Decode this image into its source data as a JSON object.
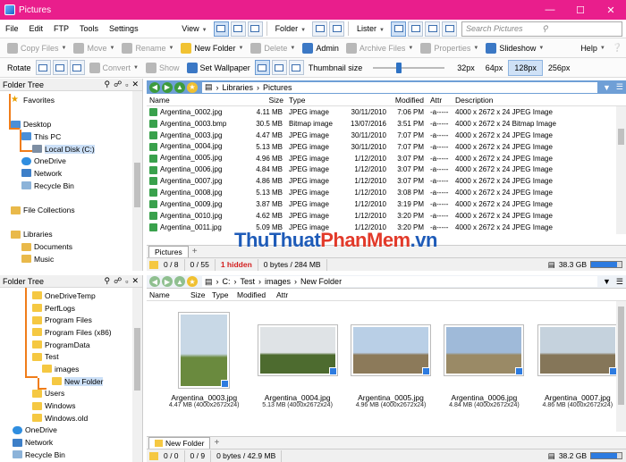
{
  "window": {
    "title": "Pictures"
  },
  "menu": {
    "items": [
      "File",
      "Edit",
      "FTP",
      "Tools",
      "Settings"
    ],
    "view_label": "View",
    "folder_label": "Folder",
    "lister_label": "Lister",
    "search_placeholder": "Search Pictures",
    "help_label": "Help"
  },
  "toolbar1": {
    "copy": "Copy Files",
    "move": "Move",
    "rename": "Rename",
    "new_folder": "New Folder",
    "delete": "Delete",
    "admin": "Admin",
    "archive": "Archive Files",
    "properties": "Properties",
    "slideshow": "Slideshow"
  },
  "toolbar2": {
    "rotate": "Rotate",
    "convert": "Convert",
    "show": "Show",
    "set_wallpaper": "Set Wallpaper",
    "thumb_size_label": "Thumbnail size",
    "thumb_level": 0.35,
    "sizes": [
      "32px",
      "64px",
      "128px",
      "256px"
    ],
    "active_size": "128px"
  },
  "tree_top": {
    "title": "Folder Tree",
    "items": [
      {
        "label": "Favorites",
        "icon": "star-icon",
        "indent": 0,
        "kind": "star"
      },
      {
        "label": "",
        "kind": "blank"
      },
      {
        "label": "Desktop",
        "icon": "desktop-icon",
        "indent": 0,
        "kind": "pc"
      },
      {
        "label": "This PC",
        "icon": "pc-icon",
        "indent": 1,
        "kind": "pc"
      },
      {
        "label": "Local Disk (C:)",
        "icon": "drive-icon",
        "indent": 2,
        "kind": "drive",
        "selected": true
      },
      {
        "label": "OneDrive",
        "icon": "cloud-icon",
        "indent": 1,
        "kind": "cloud"
      },
      {
        "label": "Network",
        "icon": "network-icon",
        "indent": 1,
        "kind": "net"
      },
      {
        "label": "Recycle Bin",
        "icon": "recycle-bin-icon",
        "indent": 1,
        "kind": "bin"
      },
      {
        "label": "",
        "kind": "blank"
      },
      {
        "label": "File Collections",
        "icon": "collections-icon",
        "indent": 0,
        "kind": "lib"
      },
      {
        "label": "",
        "kind": "blank"
      },
      {
        "label": "Libraries",
        "icon": "libraries-icon",
        "indent": 0,
        "kind": "lib"
      },
      {
        "label": "Documents",
        "icon": "documents-icon",
        "indent": 1,
        "kind": "lib"
      },
      {
        "label": "Music",
        "icon": "music-icon",
        "indent": 1,
        "kind": "lib"
      }
    ]
  },
  "tree_bottom": {
    "title": "Folder Tree",
    "items": [
      {
        "label": "OneDriveTemp",
        "indent": 2
      },
      {
        "label": "PerfLogs",
        "indent": 2
      },
      {
        "label": "Program Files",
        "indent": 2
      },
      {
        "label": "Program Files (x86)",
        "indent": 2
      },
      {
        "label": "ProgramData",
        "indent": 2
      },
      {
        "label": "Test",
        "indent": 2
      },
      {
        "label": "images",
        "indent": 3
      },
      {
        "label": "New Folder",
        "indent": 4,
        "selected": true
      },
      {
        "label": "Users",
        "indent": 2
      },
      {
        "label": "Windows",
        "indent": 2
      },
      {
        "label": "Windows.old",
        "indent": 2
      },
      {
        "label": "OneDrive",
        "indent": 0,
        "kind": "cloud"
      },
      {
        "label": "Network",
        "indent": 0,
        "kind": "net"
      },
      {
        "label": "Recycle Bin",
        "indent": 0,
        "kind": "bin"
      }
    ]
  },
  "top_lister": {
    "path": [
      "Libraries",
      "Pictures"
    ],
    "columns": [
      "Name",
      "Size",
      "Type",
      "Modified",
      "Attr",
      "Description"
    ],
    "rows": [
      [
        "Argentina_0002.jpg",
        "4.11 MB",
        "JPEG image",
        "30/11/2010",
        "7:06 PM",
        "-a-----",
        "4000 x 2672 x 24 JPEG Image"
      ],
      [
        "Argentina_0003.bmp",
        "30.5 MB",
        "Bitmap image",
        "13/07/2016",
        "3:51 PM",
        "-a-----",
        "4000 x 2672 x 24 Bitmap Image"
      ],
      [
        "Argentina_0003.jpg",
        "4.47 MB",
        "JPEG image",
        "30/11/2010",
        "7:07 PM",
        "-a-----",
        "4000 x 2672 x 24 JPEG Image"
      ],
      [
        "Argentina_0004.jpg",
        "5.13 MB",
        "JPEG image",
        "30/11/2010",
        "7:07 PM",
        "-a-----",
        "4000 x 2672 x 24 JPEG Image"
      ],
      [
        "Argentina_0005.jpg",
        "4.96 MB",
        "JPEG image",
        "1/12/2010",
        "3:07 PM",
        "-a-----",
        "4000 x 2672 x 24 JPEG Image"
      ],
      [
        "Argentina_0006.jpg",
        "4.84 MB",
        "JPEG image",
        "1/12/2010",
        "3:07 PM",
        "-a-----",
        "4000 x 2672 x 24 JPEG Image"
      ],
      [
        "Argentina_0007.jpg",
        "4.86 MB",
        "JPEG image",
        "1/12/2010",
        "3:07 PM",
        "-a-----",
        "4000 x 2672 x 24 JPEG Image"
      ],
      [
        "Argentina_0008.jpg",
        "5.13 MB",
        "JPEG image",
        "1/12/2010",
        "3:08 PM",
        "-a-----",
        "4000 x 2672 x 24 JPEG Image"
      ],
      [
        "Argentina_0009.jpg",
        "3.87 MB",
        "JPEG image",
        "1/12/2010",
        "3:19 PM",
        "-a-----",
        "4000 x 2672 x 24 JPEG Image"
      ],
      [
        "Argentina_0010.jpg",
        "4.62 MB",
        "JPEG image",
        "1/12/2010",
        "3:20 PM",
        "-a-----",
        "4000 x 2672 x 24 JPEG Image"
      ],
      [
        "Argentina_0011.jpg",
        "5.09 MB",
        "JPEG image",
        "1/12/2010",
        "3:20 PM",
        "-a-----",
        "4000 x 2672 x 24 JPEG Image"
      ]
    ],
    "tab": "Pictures",
    "status": {
      "sel_files": "0 / 8",
      "sel_folders": "0 / 55",
      "hidden": "1 hidden",
      "bytes": "0 bytes / 284 MB",
      "free": "38.3 GB",
      "used_fraction": 0.85
    }
  },
  "bottom_lister": {
    "path": [
      "C:",
      "Test",
      "images",
      "New Folder"
    ],
    "columns": [
      "Name",
      "Size",
      "Type",
      "Modified",
      "Attr"
    ],
    "thumbs": [
      {
        "name": "Argentina_0003.jpg",
        "meta": "4.47 MB (4000x2672x24)",
        "portrait": true,
        "sky": "#c8d8e6",
        "ground": "#6a8a3e"
      },
      {
        "name": "Argentina_0004.jpg",
        "meta": "5.13 MB (4000x2672x24)",
        "portrait": false,
        "sky": "#dfe3e6",
        "ground": "#4d6b2f"
      },
      {
        "name": "Argentina_0005.jpg",
        "meta": "4.96 MB (4000x2672x24)",
        "portrait": false,
        "sky": "#b9cfe6",
        "ground": "#8c7a5a"
      },
      {
        "name": "Argentina_0006.jpg",
        "meta": "4.84 MB (4000x2672x24)",
        "portrait": false,
        "sky": "#9fbad9",
        "ground": "#9a8a66"
      },
      {
        "name": "Argentina_0007.jpg",
        "meta": "4.86 MB (4000x2672x24)",
        "portrait": false,
        "sky": "#c5d2dd",
        "ground": "#857659"
      }
    ],
    "tab": "New Folder",
    "status": {
      "sel_files": "0 / 0",
      "sel_folders": "0 / 9",
      "bytes": "0 bytes / 42.9 MB",
      "free": "38.2 GB",
      "used_fraction": 0.85
    }
  },
  "watermark": {
    "part1": "ThuThuat",
    "part2": "PhanMem",
    "part3": ".vn"
  },
  "colors": {
    "titlebar": "#e91e8c",
    "tree_line": "#f07d1a",
    "nav_blue": "#6f9fd6"
  }
}
